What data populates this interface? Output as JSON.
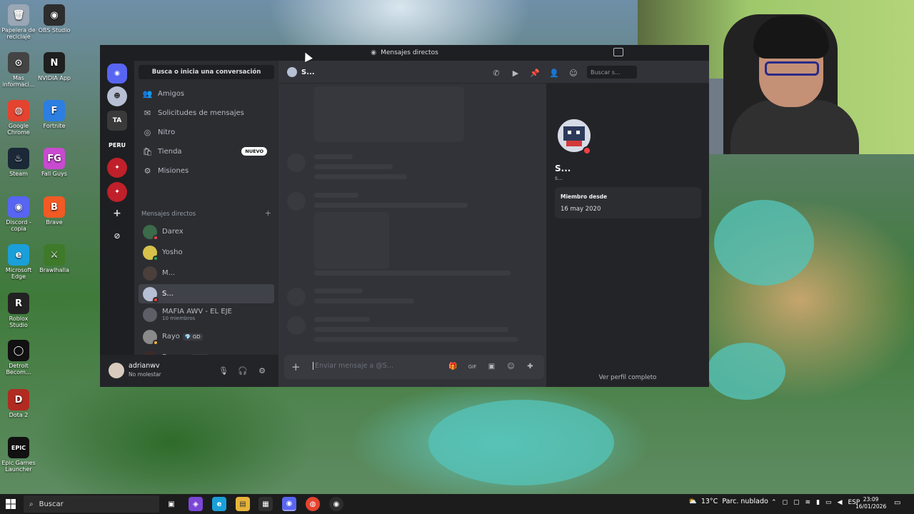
{
  "desktop": {
    "icons": [
      {
        "label": "Papelera de reciclaje",
        "color": "#9aa7b5",
        "glyph": "🗑"
      },
      {
        "label": "OBS Studio",
        "color": "#2d2d2d",
        "glyph": "◉"
      },
      {
        "label": "Mas informaci...",
        "color": "#444",
        "glyph": "⊙"
      },
      {
        "label": "NVIDIA App",
        "color": "#1f1f1f",
        "glyph": "N"
      },
      {
        "label": "Google Chrome",
        "color": "#e4432f",
        "glyph": "◍"
      },
      {
        "label": "Fortnite",
        "color": "#2c7ee0",
        "glyph": "F"
      },
      {
        "label": "Steam",
        "color": "#1b2838",
        "glyph": "♨"
      },
      {
        "label": "Fall Guys",
        "color": "#c94ad0",
        "glyph": "FG"
      },
      {
        "label": "Discord - copia",
        "color": "#5865f2",
        "glyph": "◉"
      },
      {
        "label": "Brave",
        "color": "#f15a24",
        "glyph": "B"
      },
      {
        "label": "Microsoft Edge",
        "color": "#1a9fd9",
        "glyph": "e"
      },
      {
        "label": "Brawlhalla",
        "color": "#3e7a2a",
        "glyph": "⚔"
      },
      {
        "label": "Roblox Studio",
        "color": "#222",
        "glyph": "R"
      },
      {
        "label": "Detroit Becom...",
        "color": "#111",
        "glyph": "◯"
      },
      {
        "label": "Dota 2",
        "color": "#b12b21",
        "glyph": "D"
      },
      {
        "label": "Epic Games Launcher",
        "color": "#111",
        "glyph": "EPIC"
      }
    ]
  },
  "discord": {
    "window_title": "Mensajes directos",
    "search_conversation": "Busca o inicia una conversación",
    "nav": [
      {
        "label": "Amigos",
        "icon": "👥"
      },
      {
        "label": "Solicitudes de mensajes",
        "icon": "✉"
      },
      {
        "label": "Nitro",
        "icon": "◎"
      },
      {
        "label": "Tienda",
        "icon": "🛍",
        "badge": "NUEVO"
      },
      {
        "label": "Misiones",
        "icon": "⚙"
      }
    ],
    "dm_section_title": "Mensajes directos",
    "dm_add": "+",
    "dms": [
      {
        "name": "Darex",
        "sub": "",
        "avatar": "#3b6b4a",
        "status": "#f23f43"
      },
      {
        "name": "Yosho",
        "sub": "",
        "avatar": "#d6c24a",
        "status": "#23a55a"
      },
      {
        "name": "M...",
        "sub": "",
        "avatar": "#4a3f3a",
        "status": ""
      },
      {
        "name": "S...",
        "sub": "",
        "avatar": "#b6bfd4",
        "status": "#f23f43"
      },
      {
        "name": "MAFIA AWV - EL EJE",
        "sub": "10 miembros",
        "avatar": "#5c5f66",
        "status": ""
      },
      {
        "name": "Rayo",
        "sub": "",
        "tag": "💎 GD",
        "avatar": "#8a8a8a",
        "status": "#f0b232"
      },
      {
        "name": "Dragon",
        "sub": "",
        "tag": "🎨 jal",
        "avatar": "#3a2a2a",
        "status": "#23a55a"
      }
    ],
    "user": {
      "name": "adrianwv",
      "status": "No molestar"
    },
    "chat_header": {
      "name": "S...",
      "search_placeholder": "Buscar s..."
    },
    "composer_placeholder": "Enviar mensaje a @S...",
    "profile": {
      "name": "S...",
      "handle": "s...",
      "member_since_label": "Miembro desde",
      "member_since_value": "16 may 2020",
      "full_profile": "Ver perfil completo"
    }
  },
  "taskbar": {
    "search": "Buscar",
    "weather_temp": "13°C",
    "weather_desc": "Parc. nublado",
    "language": "ESP",
    "time": "23:09",
    "date": "16/01/2026"
  }
}
